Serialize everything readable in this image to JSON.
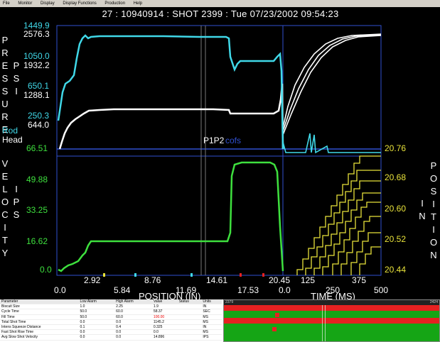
{
  "menubar": {
    "items": [
      "File",
      "Monitor",
      "Display",
      "Display Functions",
      "Production",
      "Help"
    ]
  },
  "header": {
    "title": "27 : 10940914 : SHOT 2399 : Tue  07/23/2002  09:54:23"
  },
  "pressure_axis": {
    "label_letters": [
      "P",
      "R",
      "E",
      "S",
      "S",
      "U",
      "R",
      "E"
    ],
    "unit_letters": [
      "P",
      "S",
      "I"
    ],
    "rod_ticks": [
      "1449.9",
      "1050.0",
      "650.1",
      "250.3"
    ],
    "head_ticks": [
      "2576.3",
      "1932.2",
      "1288.1",
      "644.0"
    ],
    "rod_label": "Rod",
    "head_label": "Head"
  },
  "velocity_axis": {
    "label_letters": [
      "V",
      "E",
      "L",
      "O",
      "C",
      "I",
      "T",
      "Y"
    ],
    "unit_letters": [
      "I",
      "P",
      "S"
    ],
    "ticks": [
      "66.51",
      "49.88",
      "33.25",
      "16.62",
      "0.0"
    ]
  },
  "position_axis_right": {
    "label_letters": [
      "P",
      "O",
      "S",
      "I",
      "T",
      "I",
      "O",
      "N"
    ],
    "unit_letters": [
      "I",
      "N"
    ],
    "ticks": [
      "20.76",
      "20.68",
      "20.60",
      "20.52",
      "20.44"
    ]
  },
  "x_position": {
    "label": "POSITION (IN)",
    "ticks_upper": [
      "2.92",
      "8.76",
      "14.61",
      "20.45"
    ],
    "ticks_lower": [
      "0.0",
      "5.84",
      "11.69",
      "17.53"
    ]
  },
  "x_time": {
    "label": "TIME (MS)",
    "ticks_upper": [
      "0.0",
      "125",
      "375"
    ],
    "ticks_lower": [
      "250",
      "500"
    ]
  },
  "markers": {
    "p1p2": "P1P2",
    "cofs": "cofs"
  },
  "colors": {
    "rod": "#40d8e8",
    "head": "#ffffff",
    "velocity": "#3ee03e",
    "position": "#e8e23a",
    "marker_red": "#e62121"
  },
  "params_table": {
    "headers": [
      "Parameter",
      "Low Alarm",
      "High Alarm",
      "Value",
      "Status",
      "Units"
    ],
    "rows": [
      [
        "Biscuit Size",
        "1.0",
        "2.25",
        "1.9",
        "",
        "IN"
      ],
      [
        "Cycle Time",
        "50.0",
        "60.0",
        "58.37",
        "",
        "SEC"
      ],
      [
        "Fill Time",
        "50.0",
        "60.0",
        "100.00",
        "",
        "MS"
      ],
      [
        "Total Shot Time",
        "0.0",
        "0.0",
        "1145.2",
        "",
        "MS"
      ],
      [
        "Intens Squeeze Distance",
        "0.1",
        "0.4",
        "0.325",
        "",
        "IN"
      ],
      [
        "Fast Shot Rise Time",
        "0.0",
        "0.0",
        "0.0",
        "",
        "MS"
      ],
      [
        "Avg Slow Shot Velocity",
        "0.0",
        "0.0",
        "14.896",
        "",
        "IPS"
      ]
    ]
  },
  "strip": {
    "left_label": "2379",
    "right_label": "2424"
  }
}
